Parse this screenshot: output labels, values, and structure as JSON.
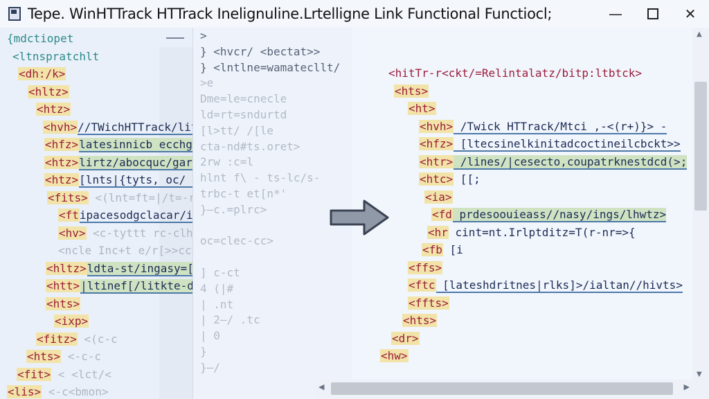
{
  "window": {
    "title": "Tepe. WinHTTrack HTTrack Inelignuline.Lrtelligne  Link  Functional Functiocl;",
    "minimize": "—",
    "close": "✕"
  },
  "left_pane": {
    "lines": [
      {
        "t": "{mdctiopet",
        "c": "teal"
      },
      {
        "t": "<ltnspratchlt",
        "c": "teal"
      },
      {
        "t": "<dh:/k>",
        "c": "tag"
      },
      {
        "t": "<hltz>",
        "c": "tag"
      },
      {
        "t": "<htz>",
        "c": "tag"
      },
      {
        "t": "<hvh>",
        "c": "tag",
        "link": "//TWichHTTrack/litrs>|]"
      },
      {
        "t": "<hfz>",
        "c": "tag",
        "link": "latesinnicb ecchgjnajupcinqcalukt>>{"
      },
      {
        "t": "<htz>",
        "c": "tag",
        "link": "lirtz/abocquc/gargaps-erp/dlaly>{"
      },
      {
        "t": "<htz>",
        "c": "tag",
        "link": "[lnts|{tyts, oc/ ttcer Prrc=trass> <ct"
      },
      {
        "t": "<fits>",
        "c": "tag",
        "faint": "<(lnt=ft=|/t=-realtatsa= redlatcekctions"
      },
      {
        "t": "<ft",
        "c": "tag",
        "link": "ipacesodgclacar/iwts>/lhvts/ltate>"
      },
      {
        "t": "<hv>",
        "c": "tag",
        "faint": "<c-tyttt rc-clhr>=[<{]"
      },
      {
        "t": "<ncle",
        "c": "faint",
        "faint": "Inc+t e/r[>>cctt>>bw>oo-pextwoicemtetl"
      },
      {
        "t": "<hltz>",
        "c": "tag",
        "link": "ldta-st/ingasy=[(r-[, ,) >"
      },
      {
        "t": "<htt>",
        "c": "tag",
        "link": "|ltinef[/litkte-draitasicdty/ePrho-[>"
      },
      {
        "t": "<hts>",
        "c": "tag"
      },
      {
        "t": "<ixp>",
        "c": "tag"
      },
      {
        "t": "<fitz>",
        "c": "tag",
        "faint": "<(c-c"
      },
      {
        "t": "<hts>",
        "c": "tag",
        "faint": "<-c-c"
      },
      {
        "t": "<fit>",
        "c": "tag",
        "faint": "< <lct/<"
      },
      {
        "t": "<lis>",
        "c": "tag",
        "faint": "<-c<bmon>"
      }
    ]
  },
  "middle_pane": {
    "lines": [
      ">",
      "}  <hvcr/          <bectat>>",
      "}  <lntlne=wamatecllt/",
      "    >e",
      "    Dme=le=cnecle",
      "    ld=rt=sndurtd",
      "    [l>tt/ /[le",
      "    cta-nd#ts.oret>",
      "2rw :c=l",
      "hlnt f\\ - ts-lc/s-",
      "trbc-t et[n*'",
      "}–c.=plrc>",
      "",
      "oc=clec-cc>",
      "",
      "] c-ct",
      "4 (|#",
      "| .nt",
      "| 2–/ .tc",
      "| 0",
      "}",
      "}–/"
    ]
  },
  "right_pane": {
    "lines": [
      {
        "t": "<hitTr-r<ckt/=Relintalatz/bitp:ltbtck>",
        "c": "tag"
      },
      {
        "t": "<hts>",
        "c": "tag"
      },
      {
        "t": "<ht>",
        "c": "tag"
      },
      {
        "t": "<hvh>",
        "c": "tag",
        "link": "/Twick HTTrack/Mtci ,-<(r+)}> -"
      },
      {
        "t": "<hfz>",
        "c": "tag",
        "link": "[ltecsinelkinitadcoctineilcbckt>>"
      },
      {
        "t": "<htr>",
        "c": "tag",
        "link": "/lines/|cesecto,coupatrknestdcd(>;"
      },
      {
        "t": "<htc>",
        "c": "tag",
        "faint": "[[;"
      },
      {
        "t": "<ia>",
        "c": "tag"
      },
      {
        "t": "<fd",
        "c": "tag",
        "link": "prdesoouieass//nasy/ings/lhwtz>"
      },
      {
        "t": "<hr",
        "c": "tag",
        "faint": "cint=nt.Irlptditz=T(r-nr=>{"
      },
      {
        "t": "<fb",
        "c": "tag",
        "faint": "[i"
      },
      {
        "t": "<ffs>",
        "c": "tag"
      },
      {
        "t": "<ftc",
        "c": "tag",
        "link": "[lateshdritnes|rlks]>/ialtan//hivts>"
      },
      {
        "t": "<ffts>",
        "c": "tag"
      },
      {
        "t": "<hts>",
        "c": "tag"
      },
      {
        "t": "<dr>",
        "c": "tag"
      },
      {
        "t": "<hw>",
        "c": "tag"
      }
    ]
  }
}
